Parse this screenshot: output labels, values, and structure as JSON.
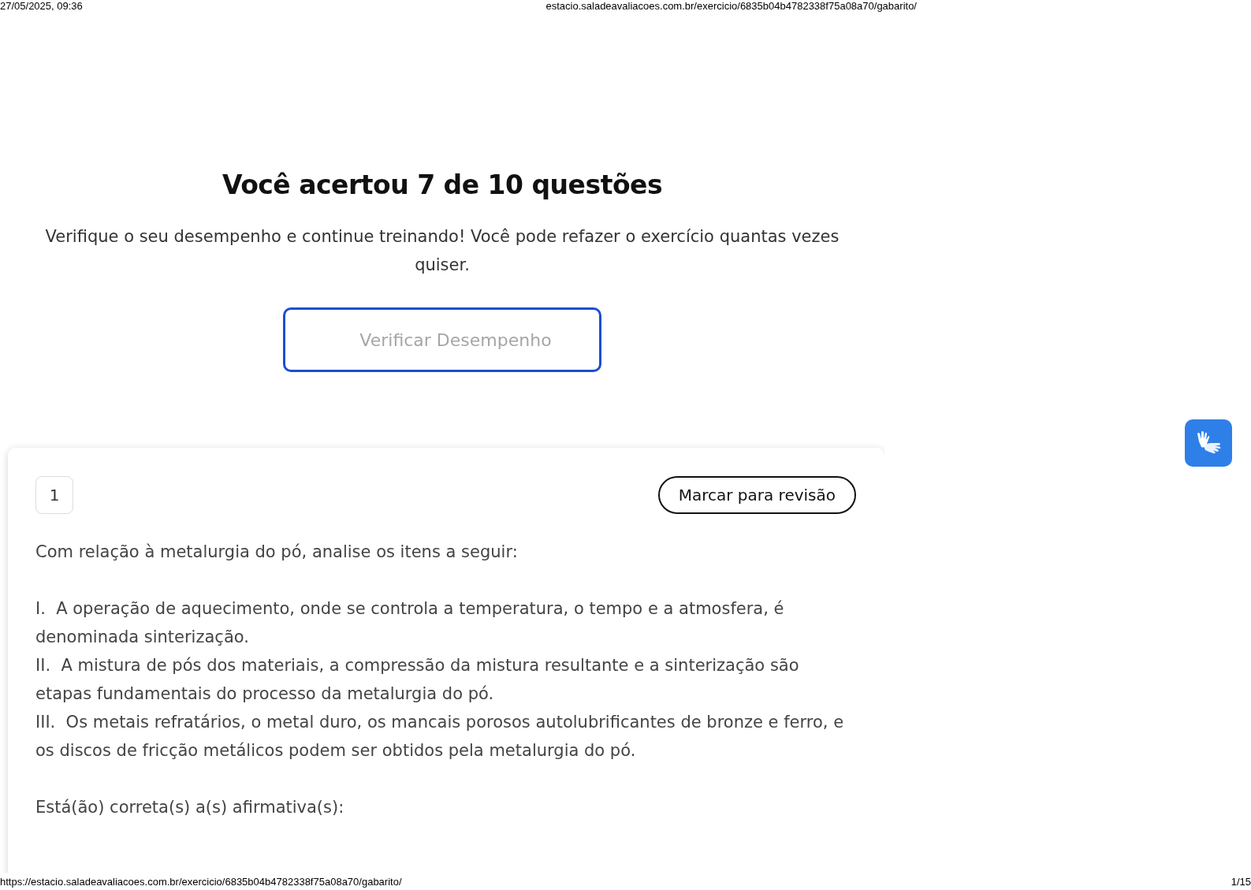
{
  "print_header": {
    "date": "27/05/2025, 09:36",
    "url": "estacio.saladeavaliacoes.com.br/exercicio/6835b04b4782338f75a08a70/gabarito/"
  },
  "result": {
    "title": "Você acertou 7 de 10 questões",
    "subtitle": "Verifique o seu desempenho e continue treinando! Você pode refazer o exercício quantas vezes quiser.",
    "button": "Verificar Desempenho"
  },
  "question": {
    "number": "1",
    "review_button": "Marcar para revisão",
    "paragraphs": [
      {
        "kind": "intro",
        "text": "Com relação à metalurgia do pó, analise os itens a seguir:"
      },
      {
        "kind": "item",
        "text": "I.  A operação de aquecimento, onde se controla a temperatura, o tempo e a atmosfera, é denominada sinterização."
      },
      {
        "kind": "item",
        "text": "II.  A mistura de pós dos materiais, a compressão da mistura resultante e a sinterização são etapas fundamentais do processo da metalurgia do pó."
      },
      {
        "kind": "item",
        "text": "III.  Os metais refratários, o metal duro, os mancais porosos autolubrificantes de bronze e ferro, e os discos de fricção metálicos podem ser obtidos pela metalurgia do pó."
      },
      {
        "kind": "prompt",
        "text": "Está(ão) correta(s) a(s) afirmativa(s):"
      }
    ]
  },
  "print_footer": {
    "url": "https://estacio.saladeavaliacoes.com.br/exercicio/6835b04b4782338f75a08a70/gabarito/",
    "page": "1/15"
  }
}
